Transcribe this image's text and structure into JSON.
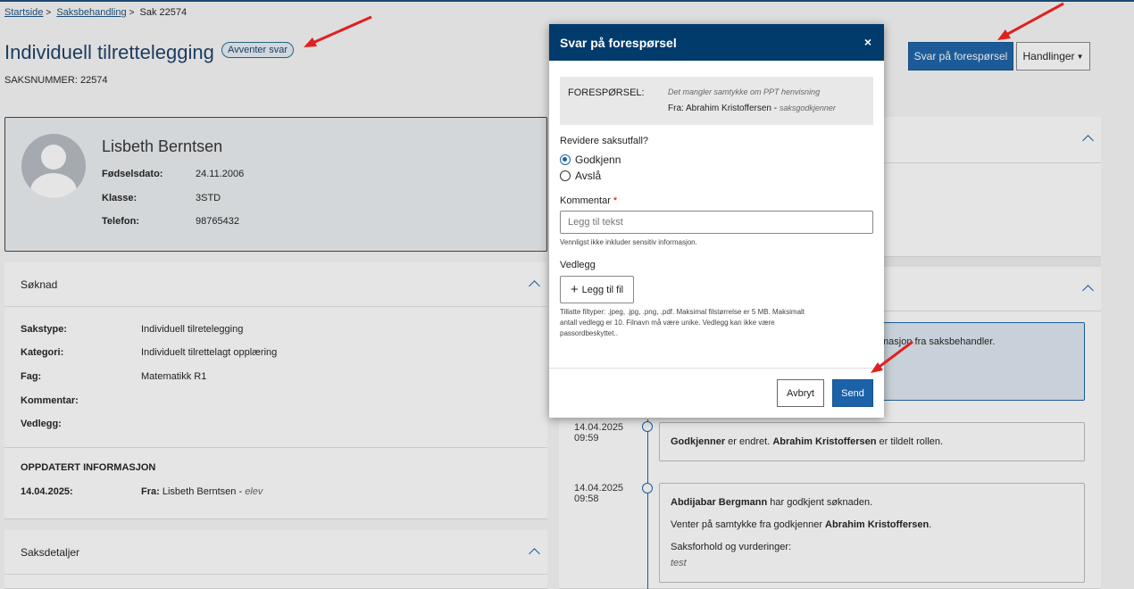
{
  "breadcrumb": {
    "items": [
      "Startside",
      "Saksbehandling",
      "Sak 22574"
    ]
  },
  "page": {
    "title": "Individuell tilrettelegging",
    "status_badge": "Avventer svar",
    "case_number": "SAKSNUMMER: 22574"
  },
  "toolbar": {
    "respond_label": "Svar på forespørsel",
    "actions_label": "Handlinger"
  },
  "profile": {
    "name": "Lisbeth Berntsen",
    "fields": [
      {
        "label": "Fødselsdato:",
        "value": "24.11.2006"
      },
      {
        "label": "Klasse:",
        "value": "3STD"
      },
      {
        "label": "Telefon:",
        "value": "98765432"
      }
    ]
  },
  "application": {
    "title": "Søknad",
    "rows": [
      {
        "label": "Sakstype:",
        "value": "Individuell tilretelegging"
      },
      {
        "label": "Kategori:",
        "value": "Individuelt tilrettelagt opplæring"
      },
      {
        "label": "Fag:",
        "value": "Matematikk R1"
      },
      {
        "label": "Kommentar:",
        "value": ""
      },
      {
        "label": "Vedlegg:",
        "value": ""
      }
    ],
    "updated_heading": "OPPDATERT INFORMASJON",
    "updated_date": "14.04.2025:",
    "updated_from_label": "Fra:",
    "updated_from_name": "Lisbeth Berntsen",
    "updated_from_role": "elev"
  },
  "case_details": {
    "title": "Saksdetaljer"
  },
  "timeline": {
    "highlight_text": "masjon fra saksbehandler.",
    "entries": [
      {
        "date": "14.04.2025",
        "time": "09:59",
        "bold1": "Godkjenner",
        "text1": " er endret. ",
        "bold2": "Abrahim Kristoffersen",
        "text2": " er tildelt rollen."
      },
      {
        "date": "14.04.2025",
        "time": "09:58",
        "line1_bold": "Abdijabar Bergmann",
        "line1_text": " har godkjent søknaden.",
        "line2_text": "Venter på samtykke fra godkjenner ",
        "line2_bold": "Abrahim Kristoffersen",
        "line2_end": ".",
        "line3": "Saksforhold og vurderinger:",
        "line4": "test"
      }
    ]
  },
  "modal": {
    "title": "Svar på forespørsel",
    "close": "×",
    "request_label": "FORESPØRSEL:",
    "request_text": "Det mangler samtykke om PPT henvisning",
    "request_from_label": "Fra: Abrahim Kristoffersen - ",
    "request_from_role": "saksgodkjenner",
    "revise_label": "Revidere saksutfall?",
    "options": [
      {
        "label": "Godkjenn",
        "checked": true
      },
      {
        "label": "Avslå",
        "checked": false
      }
    ],
    "comment_label": "Kommentar",
    "required_mark": "*",
    "comment_placeholder": "Legg til tekst",
    "comment_hint": "Vennligst ikke inkluder sensitiv informasjon.",
    "attachments_label": "Vedlegg",
    "add_file_label": "Legg til fil",
    "file_hint_1": "Tillatte filtyper: .jpeg, .jpg, .png, .pdf. Maksimal filstørrelse er 5 MB. Maksimalt",
    "file_hint_2": "antall vedlegg er 10. Filnavn må være unike. Vedlegg kan ikke være",
    "file_hint_3": "passordbeskyttet..",
    "cancel_label": "Avbryt",
    "send_label": "Send"
  },
  "colors": {
    "primary": "#1b62a8",
    "header": "#003b6b",
    "annotation_arrow": "#e02020"
  }
}
